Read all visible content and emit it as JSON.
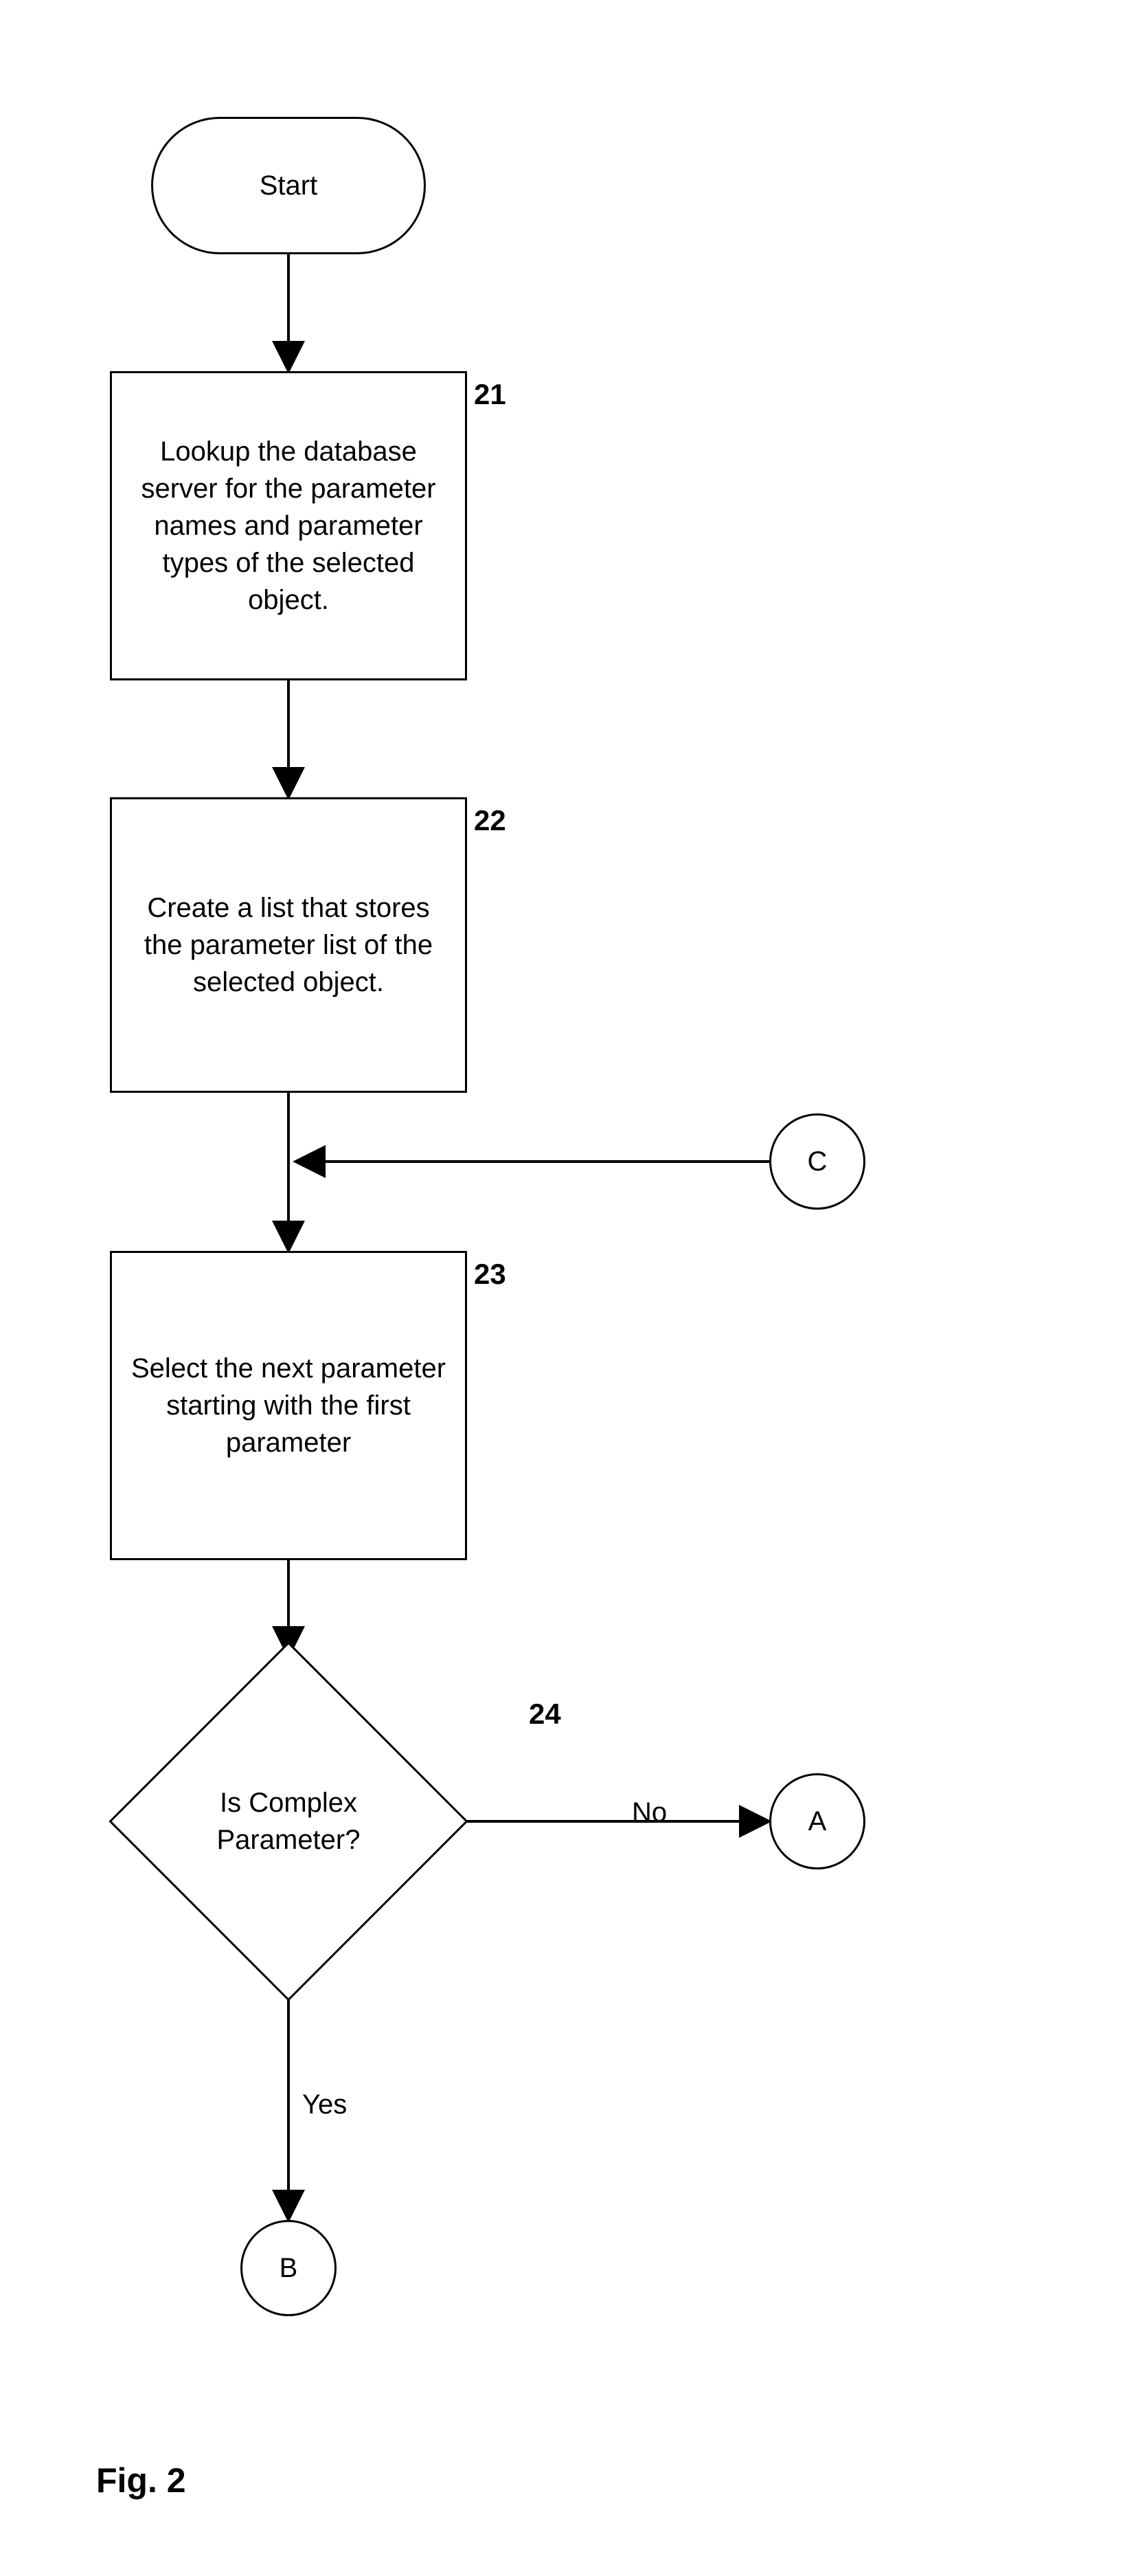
{
  "nodes": {
    "start": "Start",
    "step21": "Lookup the database server for the parameter names and parameter types of the selected object.",
    "step22": "Create a list that stores the parameter list of the selected object.",
    "step23": "Select the next parameter starting with the first parameter",
    "decision24": "Is Complex Parameter?",
    "connectorA": "A",
    "connectorB": "B",
    "connectorC": "C"
  },
  "refs": {
    "r21": "21",
    "r22": "22",
    "r23": "23",
    "r24": "24"
  },
  "edges": {
    "yes": "Yes",
    "no": "No"
  },
  "figure": "Fig. 2",
  "chart_data": {
    "type": "flowchart",
    "title": "Fig. 2",
    "nodes": [
      {
        "id": "start",
        "type": "terminator",
        "label": "Start"
      },
      {
        "id": "21",
        "type": "process",
        "label": "Lookup the database server for the parameter names and parameter types of the selected object."
      },
      {
        "id": "22",
        "type": "process",
        "label": "Create a list that stores the parameter list of the selected object."
      },
      {
        "id": "23",
        "type": "process",
        "label": "Select the next parameter starting with the first parameter"
      },
      {
        "id": "24",
        "type": "decision",
        "label": "Is Complex Parameter?"
      },
      {
        "id": "A",
        "type": "connector",
        "label": "A"
      },
      {
        "id": "B",
        "type": "connector",
        "label": "B"
      },
      {
        "id": "C",
        "type": "connector",
        "label": "C"
      }
    ],
    "edges": [
      {
        "from": "start",
        "to": "21"
      },
      {
        "from": "21",
        "to": "22"
      },
      {
        "from": "22",
        "to": "23"
      },
      {
        "from": "C",
        "to": "23",
        "merge_after": "22"
      },
      {
        "from": "23",
        "to": "24"
      },
      {
        "from": "24",
        "to": "A",
        "label": "No"
      },
      {
        "from": "24",
        "to": "B",
        "label": "Yes"
      }
    ]
  }
}
